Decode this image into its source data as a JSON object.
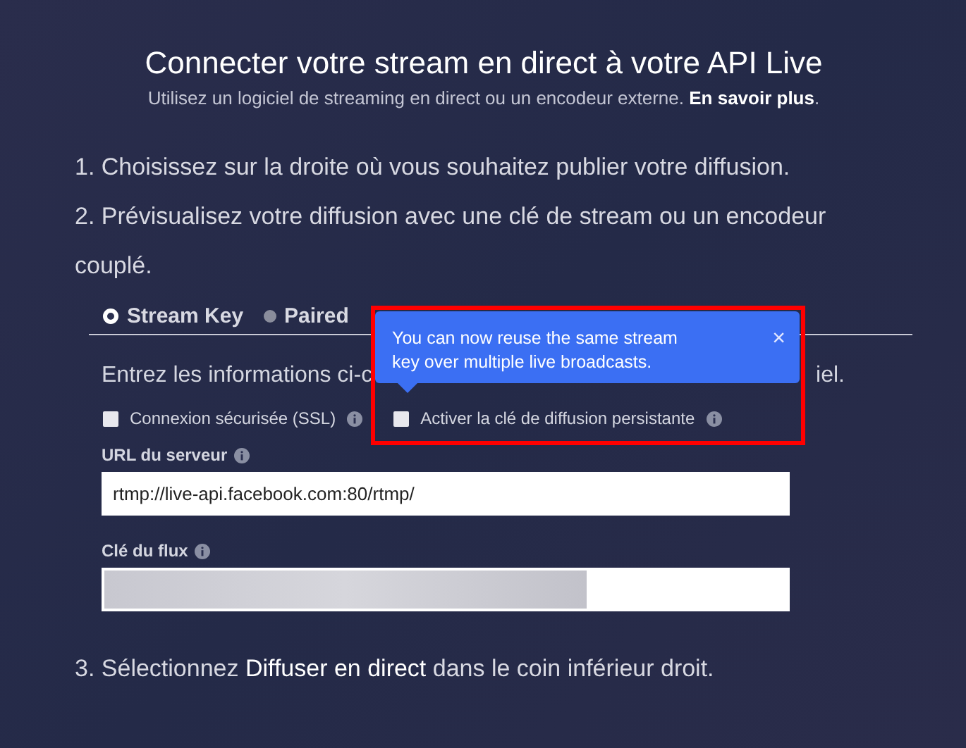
{
  "header": {
    "title": "Connecter votre stream en direct à votre API Live",
    "subtitle": "Utilisez un logiciel de streaming en direct ou un encodeur externe. **En savoir plus**."
  },
  "steps": [
    {
      "text": "1. Choisissez sur la droite où vous souhaitez publier votre diffusion."
    },
    {
      "text": "2. Prévisualisez votre diffusion avec une clé de stream ou un encodeur couplé."
    }
  ],
  "tabs": [
    {
      "label": "Stream Key",
      "selected": true
    },
    {
      "label": "Paired",
      "selected": false
    }
  ],
  "instructions": {
    "before": "Entrez les informations ci-c",
    "after": "iel."
  },
  "options": [
    {
      "label": "Connexion sécurisée (SSL)",
      "checked": false
    },
    {
      "label": "Activer la clé de diffusion persistante",
      "checked": false
    }
  ],
  "fields": [
    {
      "label": "URL du serveur",
      "value": "rtmp://live-api.facebook.com:80/rtmp/",
      "redacted": false
    },
    {
      "label": "Clé du flux",
      "redacted": true
    }
  ],
  "final_step": {
    "before": "3. Sélectionnez ",
    "link": "Diffuser en direct",
    "after": " dans le coin inférieur droit."
  },
  "tooltip": {
    "text": "You can now reuse the same stream key over multiple live broadcasts.",
    "close": "×",
    "highlighted": true
  }
}
